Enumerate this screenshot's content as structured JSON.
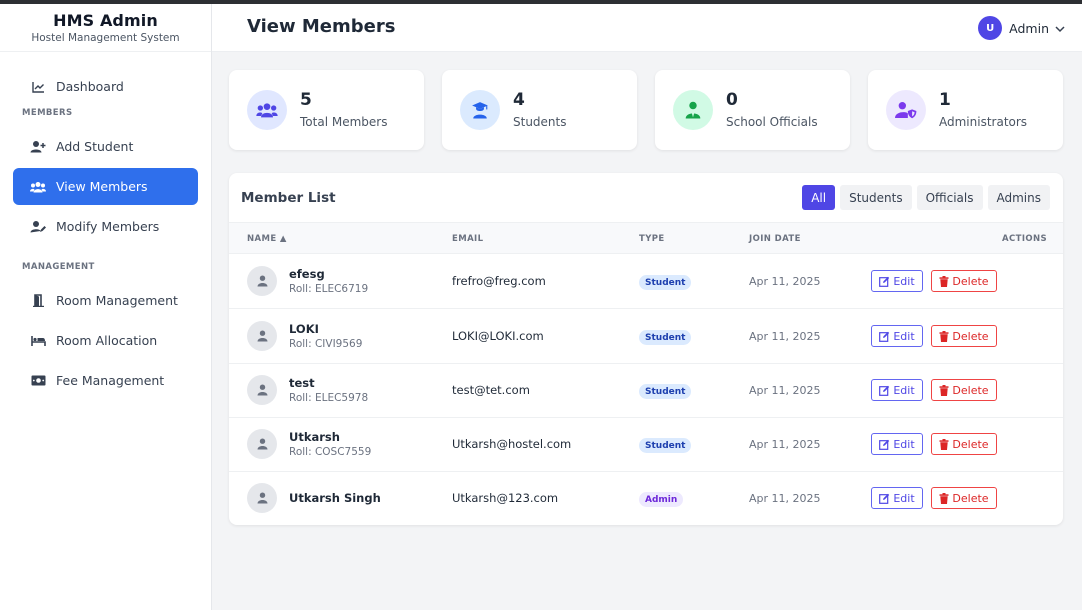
{
  "brand": {
    "title": "HMS Admin",
    "subtitle": "Hostel Management System"
  },
  "sidebar": {
    "dashboard": "Dashboard",
    "section_members": "MEMBERS",
    "add_student": "Add Student",
    "view_members": "View Members",
    "modify_members": "Modify Members",
    "section_management": "MANAGEMENT",
    "room_management": "Room Management",
    "room_allocation": "Room Allocation",
    "fee_management": "Fee Management"
  },
  "header": {
    "title": "View Members",
    "user_initial": "U",
    "user_name": "Admin"
  },
  "stats": [
    {
      "value": "5",
      "label": "Total Members",
      "color": "#4f46e5",
      "bg": "#e0e7ff",
      "icon": "users-icon"
    },
    {
      "value": "4",
      "label": "Students",
      "color": "#2563eb",
      "bg": "#dbeafe",
      "icon": "graduate-icon"
    },
    {
      "value": "0",
      "label": "School Officials",
      "color": "#16a34a",
      "bg": "#d1fae5",
      "icon": "official-icon"
    },
    {
      "value": "1",
      "label": "Administrators",
      "color": "#7c3aed",
      "bg": "#ede9fe",
      "icon": "user-shield-icon"
    }
  ],
  "panel": {
    "title": "Member List",
    "filters": [
      "All",
      "Students",
      "Officials",
      "Admins"
    ],
    "columns": {
      "name": "NAME ▲",
      "email": "EMAIL",
      "type": "TYPE",
      "join_date": "JOIN DATE",
      "actions": "ACTIONS"
    },
    "edit_label": "Edit",
    "delete_label": "Delete"
  },
  "members": [
    {
      "name": "efesg",
      "roll": "Roll: ELEC6719",
      "email": "frefro@freg.com",
      "type": "Student",
      "join_date": "Apr 11, 2025"
    },
    {
      "name": "LOKI",
      "roll": "Roll: CIVI9569",
      "email": "LOKI@LOKI.com",
      "type": "Student",
      "join_date": "Apr 11, 2025"
    },
    {
      "name": "test",
      "roll": "Roll: ELEC5978",
      "email": "test@tet.com",
      "type": "Student",
      "join_date": "Apr 11, 2025"
    },
    {
      "name": "Utkarsh",
      "roll": "Roll: COSC7559",
      "email": "Utkarsh@hostel.com",
      "type": "Student",
      "join_date": "Apr 11, 2025"
    },
    {
      "name": "Utkarsh Singh",
      "roll": "",
      "email": "Utkarsh@123.com",
      "type": "Admin",
      "join_date": "Apr 11, 2025"
    }
  ],
  "colors": {
    "primary": "#4f46e5",
    "active_nav": "#2f6fec",
    "danger": "#dc2626"
  }
}
